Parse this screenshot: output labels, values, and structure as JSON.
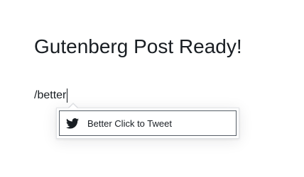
{
  "post": {
    "title": "Gutenberg Post Ready!"
  },
  "paragraph": {
    "text": "/better"
  },
  "autocomplete": {
    "options": [
      {
        "label": "Better Click to Tweet",
        "icon": "twitter-bird-icon"
      }
    ]
  },
  "colors": {
    "text": "#191e23",
    "option_border": "#555d66",
    "popover_border": "#e2e4e7",
    "icon": "#191e23"
  }
}
